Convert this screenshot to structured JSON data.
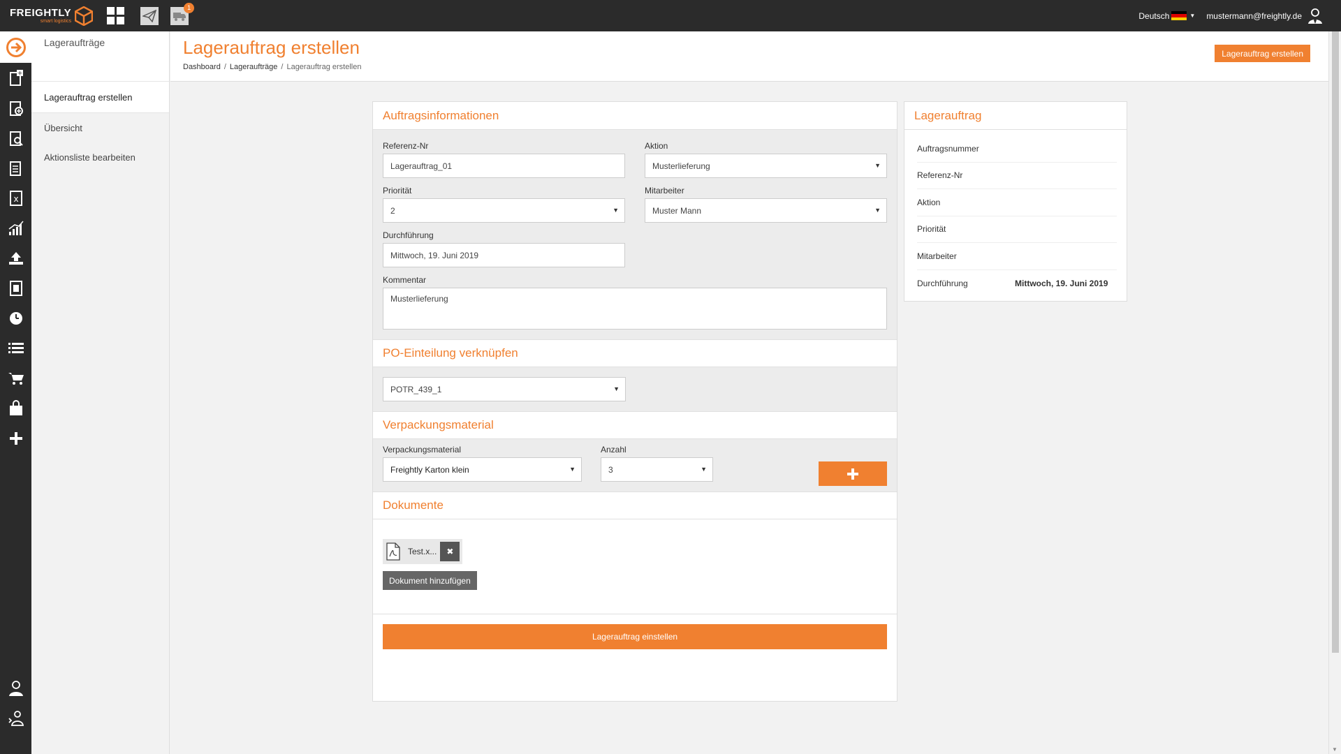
{
  "topbar": {
    "brand_name": "FREIGHTLY",
    "brand_tagline": "smart logistics",
    "notification_count": "1",
    "language": "Deutsch",
    "user_email": "mustermann@freightly.de",
    "accent_color": "#f08030",
    "icons": [
      "grid-icon",
      "send-icon",
      "truck-icon"
    ]
  },
  "rail": {
    "icons": [
      "arrow-right-circle-icon",
      "new-shipment-icon",
      "add-document-icon",
      "document-search-icon",
      "document-list-icon",
      "excel-icon",
      "chart-icon",
      "upload-icon",
      "invoice-icon",
      "clock-icon",
      "list-icon",
      "cart-icon",
      "bag-icon",
      "plus-icon"
    ],
    "bottom_icons": [
      "user-icon",
      "user-switch-icon"
    ]
  },
  "subnav": {
    "header": "Lageraufträge",
    "items": [
      {
        "label": "Lagerauftrag erstellen",
        "active": true
      },
      {
        "label": "Übersicht",
        "active": false
      },
      {
        "label": "Aktionsliste bearbeiten",
        "active": false
      }
    ]
  },
  "header": {
    "title": "Lagerauftrag erstellen",
    "breadcrumb": [
      "Dashboard",
      "Lageraufträge",
      "Lagerauftrag erstellen"
    ],
    "button_label": "Lagerauftrag erstellen"
  },
  "form": {
    "section1_title": "Auftragsinformationen",
    "referenz_label": "Referenz-Nr",
    "referenz_value": "Lagerauftrag_01",
    "aktion_label": "Aktion",
    "aktion_value": "Musterlieferung",
    "prioritaet_label": "Priorität",
    "prioritaet_value": "2",
    "mitarbeiter_label": "Mitarbeiter",
    "mitarbeiter_value": "Muster Mann",
    "durchfuehrung_label": "Durchführung",
    "durchfuehrung_value": "Mittwoch, 19. Juni 2019",
    "kommentar_label": "Kommentar",
    "kommentar_value": "Musterlieferung",
    "section2_title": "PO-Einteilung verknüpfen",
    "po_value": "POTR_439_1",
    "section3_title": "Verpackungsmaterial",
    "verpackung_label": "Verpackungsmaterial",
    "verpackung_value": "Freightly Karton klein",
    "anzahl_label": "Anzahl",
    "anzahl_value": "3",
    "section4_title": "Dokumente",
    "doc_name": "Test.x...",
    "doc_add_label": "Dokument hinzufügen",
    "submit_label": "Lagerauftrag einstellen"
  },
  "summary": {
    "title": "Lagerauftrag",
    "rows": [
      {
        "key": "Auftragsnummer",
        "value": ""
      },
      {
        "key": "Referenz-Nr",
        "value": ""
      },
      {
        "key": "Aktion",
        "value": ""
      },
      {
        "key": "Priorität",
        "value": ""
      },
      {
        "key": "Mitarbeiter",
        "value": ""
      },
      {
        "key": "Durchführung",
        "value": "Mittwoch, 19. Juni 2019"
      }
    ]
  }
}
